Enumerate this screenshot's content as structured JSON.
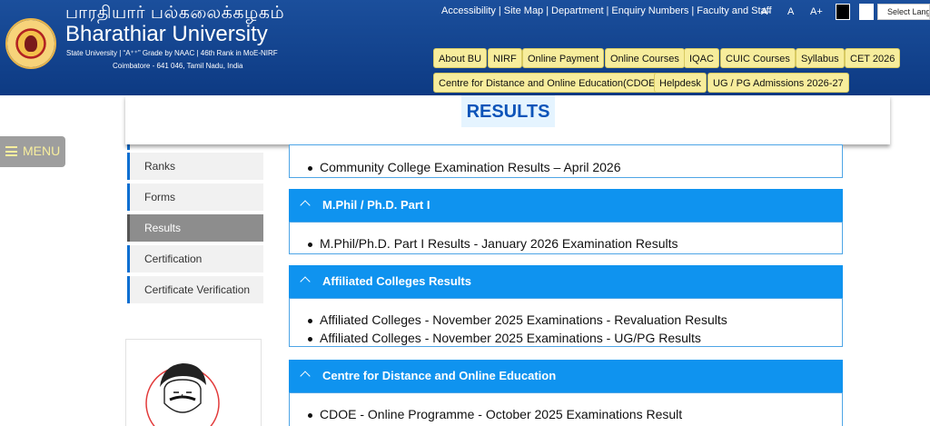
{
  "header": {
    "tamil_name": "பாரதியார் பல்கலைக்கழகம்",
    "name": "Bharathiar University",
    "subtitle": "State University | “A⁺⁺” Grade by NAAC | 46th Rank in MoE-NIRF",
    "address": "Coimbatore - 641 046, Tamil Nadu, India",
    "top_links": [
      "Accessibility",
      "Site Map",
      "Department",
      "Enquiry Numbers",
      "Faculty and Staff"
    ],
    "font_controls": [
      "A-",
      "A",
      "A+"
    ],
    "language_select": "Select Lang",
    "nav_row1": [
      "About BU",
      "NIRF",
      "Online Payment",
      "Online Courses",
      "IQAC",
      "CUIC Courses",
      "Syllabus",
      "CET 2026"
    ],
    "nav_row2": [
      "Centre for Distance and Online Education(CDOE)",
      "Helpdesk",
      "UG / PG Admissions 2026-27"
    ]
  },
  "menu_label": "MENU",
  "page_title": "RESULTS",
  "sidebar": [
    "Ranks",
    "Forms",
    "Results",
    "Certification",
    "Certificate Verification"
  ],
  "sections": [
    {
      "heading": "",
      "items": [
        "Community College Examination Results – April 2026"
      ]
    },
    {
      "heading": "M.Phil / Ph.D. Part I",
      "items": [
        "M.Phil/Ph.D. Part I Results - January 2026 Examination Results"
      ]
    },
    {
      "heading": "Affiliated Colleges Results",
      "items": [
        "Affiliated Colleges - November 2025 Examinations - Revaluation Results",
        "Affiliated Colleges - November 2025 Examinations - UG/PG Results"
      ]
    },
    {
      "heading": "Centre for Distance and Online Education",
      "items": [
        "CDOE - Online Programme - October 2025 Examinations Result"
      ]
    }
  ],
  "colors": {
    "header_bg": "#0d3a83",
    "nav_button": "#f7ed9c",
    "accordion_head": "#0f93ef",
    "title_text": "#0d54b9"
  }
}
